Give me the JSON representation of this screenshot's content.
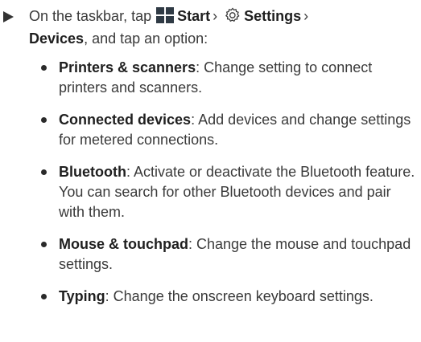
{
  "step": {
    "intro": "On the taskbar, tap",
    "start_label": "Start",
    "sep1": "›",
    "settings_label": "Settings",
    "sep2": "›",
    "devices_label": "Devices",
    "tail": ", and tap an option:",
    "start_icon": "windows-start-icon",
    "settings_icon": "gear-icon"
  },
  "options": [
    {
      "term": "Printers & scanners",
      "desc": ": Change setting to connect printers and scanners."
    },
    {
      "term": "Connected devices",
      "desc": ": Add devices and change settings for metered connections."
    },
    {
      "term": "Bluetooth",
      "desc": ": Activate or deactivate the Bluetooth feature. You can search for other Bluetooth devices and pair with them."
    },
    {
      "term": "Mouse & touchpad",
      "desc": ": Change the mouse and touchpad settings."
    },
    {
      "term": "Typing",
      "desc": ": Change the onscreen keyboard settings."
    }
  ]
}
